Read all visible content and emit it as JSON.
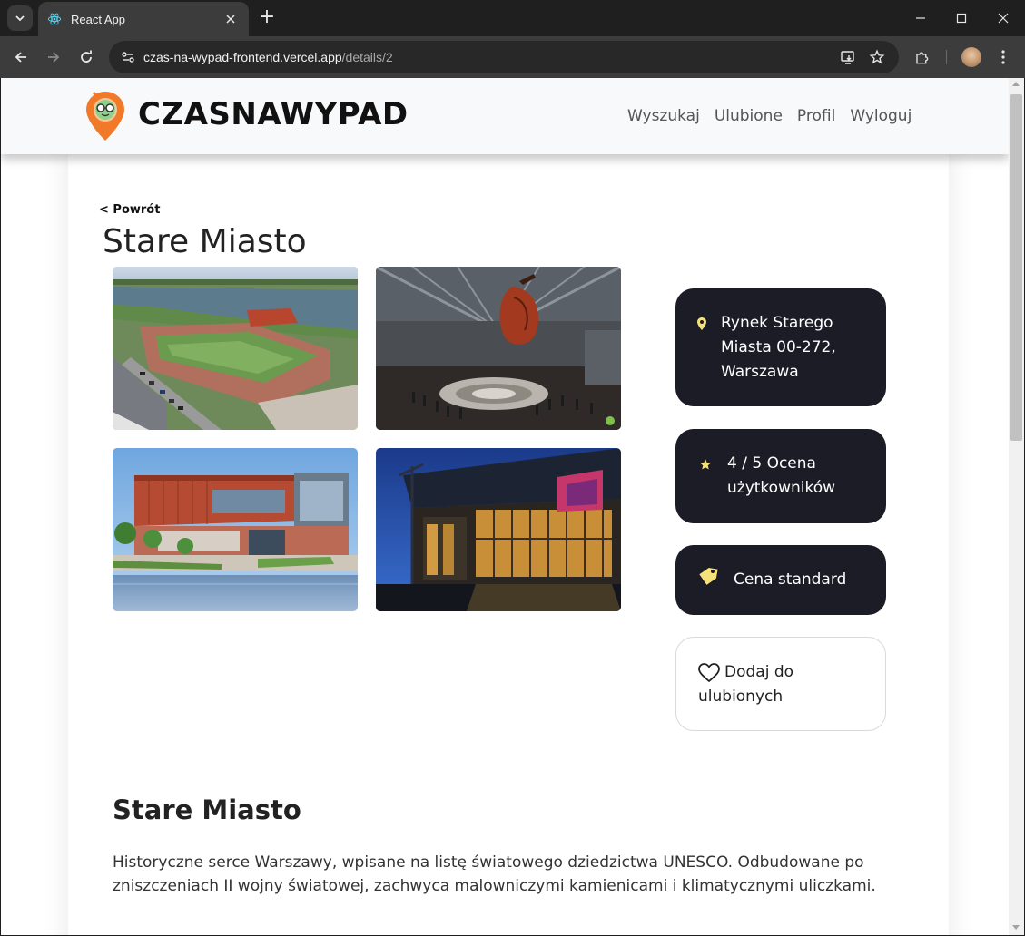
{
  "browser": {
    "tab_title": "React App",
    "url_host": "czas-na-wypad-frontend.vercel.app",
    "url_path": "/details/2"
  },
  "header": {
    "brand": "CZASNAWYPAD",
    "nav": [
      "Wyszukaj",
      "Ulubione",
      "Profil",
      "Wyloguj"
    ]
  },
  "page": {
    "back_label": "< Powrót",
    "title": "Stare Miasto"
  },
  "photos": [
    {
      "name": "photo-aerial-roof-garden"
    },
    {
      "name": "photo-interior-hall"
    },
    {
      "name": "photo-riverside-building"
    },
    {
      "name": "photo-night-entrance"
    }
  ],
  "info": {
    "address": "Rynek Starego Miasta 00-272, Warszawa",
    "rating": "4 / 5 Ocena użytkowników",
    "price": "Cena standard",
    "favorite_label": "Dodaj do ulubionych"
  },
  "description": {
    "heading": "Stare Miasto",
    "text": "Historyczne serce Warszawy, wpisane na listę światowego dziedzictwa UNESCO. Odbudowane po zniszczeniach II wojny światowej, zachwyca malowniczymi kamienicami i klimatycznymi uliczkami."
  },
  "colors": {
    "accent_orange": "#f07a2a",
    "card_dark": "#1c1c26",
    "icon_yellow": "#f6e27a"
  }
}
